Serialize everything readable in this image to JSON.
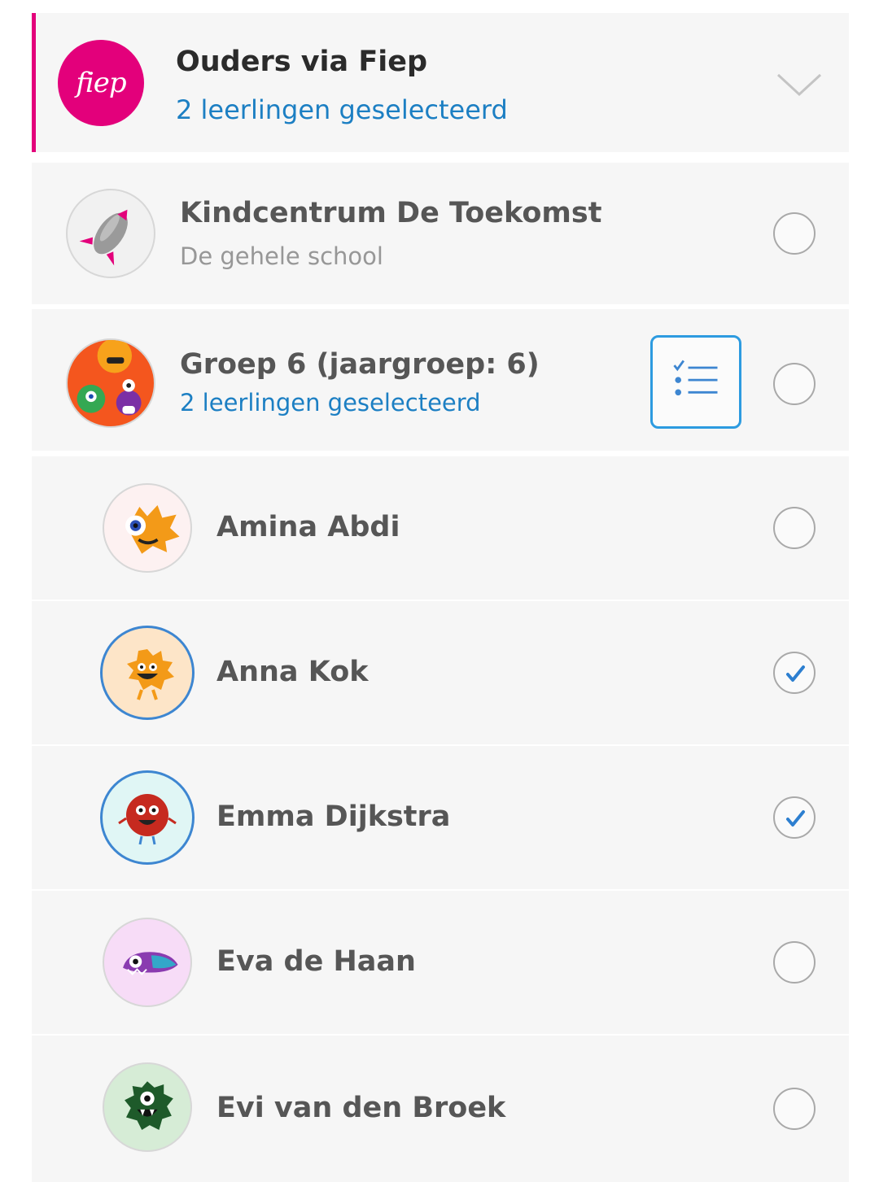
{
  "channel": {
    "logo_text": "fiep",
    "title": "Ouders via Fiep",
    "subtitle": "2 leerlingen geselecteerd",
    "expand_icon": "chevron-down-icon"
  },
  "school": {
    "title": "Kindcentrum De Toekomst",
    "subtitle": "De gehele school",
    "icon": "rocket-icon",
    "selected": false
  },
  "group": {
    "title": "Groep 6 (jaargroep: 6)",
    "subtitle": "2 leerlingen geselecteerd",
    "list_icon": "checklist-icon",
    "selected": false
  },
  "students": [
    {
      "name": "Amina Abdi",
      "selected": false,
      "avatar_bg": "#fdf1f1",
      "avatar_icon": "orange-monster-icon"
    },
    {
      "name": "Anna Kok",
      "selected": true,
      "avatar_bg": "#fde5c8",
      "avatar_icon": "orange-monster-icon"
    },
    {
      "name": "Emma Dijkstra",
      "selected": true,
      "avatar_bg": "#e0f6f5",
      "avatar_icon": "red-monster-icon"
    },
    {
      "name": "Eva de Haan",
      "selected": false,
      "avatar_bg": "#f7dcf7",
      "avatar_icon": "purple-monster-icon"
    },
    {
      "name": "Evi van den Broek",
      "selected": false,
      "avatar_bg": "#d6ecd6",
      "avatar_icon": "green-monster-icon"
    }
  ],
  "colors": {
    "accent": "#e3007b",
    "link": "#1c7fc3",
    "check": "#2d7fd0"
  }
}
